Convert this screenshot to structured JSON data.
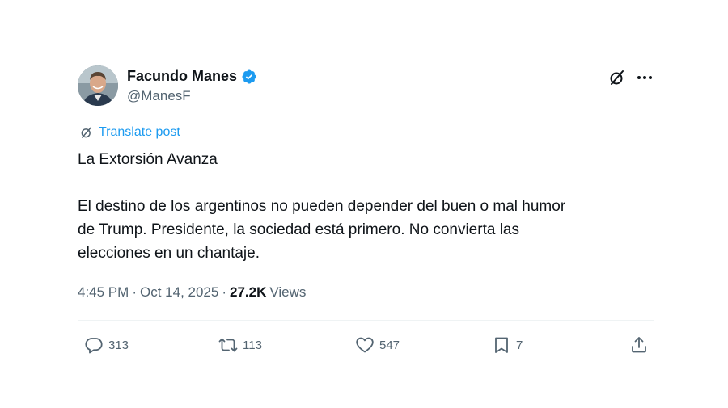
{
  "author": {
    "name": "Facundo Manes",
    "handle": "@ManesF",
    "verified": true
  },
  "translate_label": "Translate post",
  "tweet": {
    "title_line": "La Extorsión Avanza",
    "line1": "El destino de los argentinos no pueden depender del buen o mal humor",
    "line2": "de Trump. Presidente, la sociedad está primero. No convierta las",
    "line3": "elecciones en un chantaje."
  },
  "meta": {
    "time": "4:45 PM",
    "date": "Oct 14, 2025",
    "views_count": "27.2K",
    "views_label": "Views"
  },
  "actions": {
    "replies": "313",
    "reposts": "113",
    "likes": "547",
    "bookmarks": "7"
  },
  "colors": {
    "accent": "#1d9bf0",
    "text": "#0f1419",
    "muted": "#536471"
  }
}
